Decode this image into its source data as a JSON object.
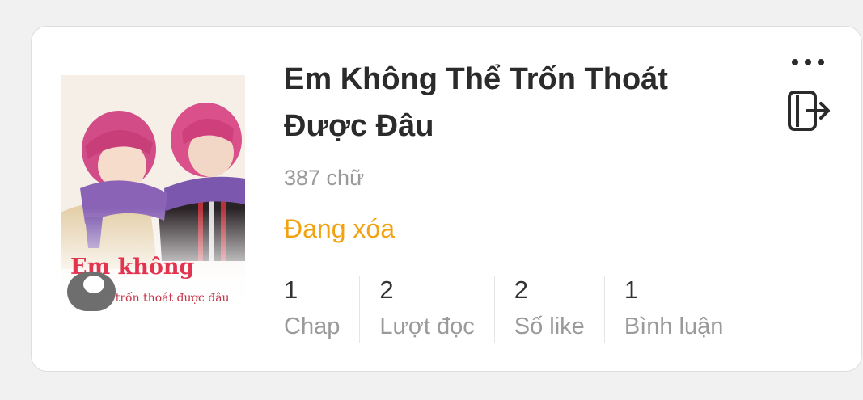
{
  "book": {
    "title": "Em Không Thể Trốn Thoát Được Đâu",
    "word_count": "387 chữ",
    "status": "Đang xóa",
    "status_color": "#f2a20f",
    "cover": {
      "title": "Em không",
      "subtitle": "thể trốn thoát được đâu"
    },
    "stats": [
      {
        "value": "1",
        "label": "Chap"
      },
      {
        "value": "2",
        "label": "Lượt đọc"
      },
      {
        "value": "2",
        "label": "Số like"
      },
      {
        "value": "1",
        "label": "Bình luận"
      }
    ]
  },
  "actions": {
    "more_icon": "more-horizontal-icon",
    "exit_icon": "exit-icon"
  }
}
